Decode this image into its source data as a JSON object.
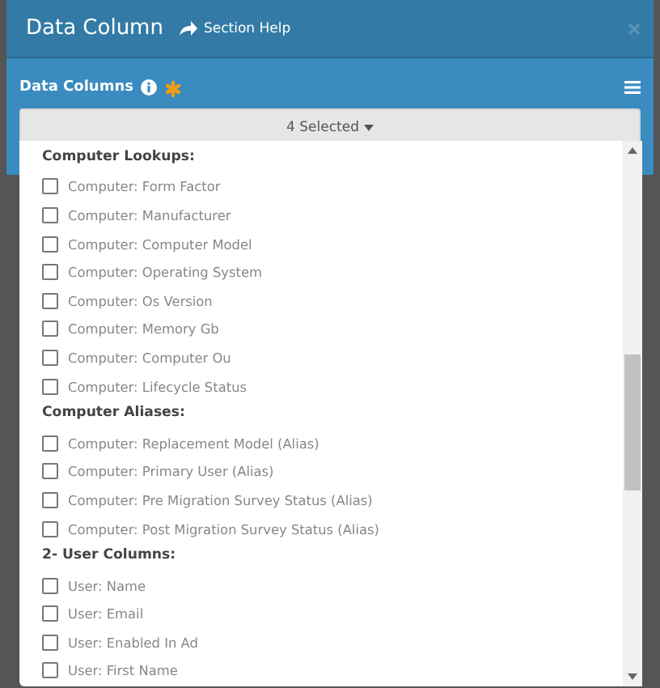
{
  "window": {
    "title": "Data Column",
    "help_link": "Section Help"
  },
  "field": {
    "label": "Data Columns",
    "required": true,
    "dropdown_value": "4 Selected"
  },
  "groups": [
    {
      "title": "Computer Lookups:",
      "items": [
        {
          "label": "Computer: Form Factor",
          "checked": false
        },
        {
          "label": "Computer: Manufacturer",
          "checked": false
        },
        {
          "label": "Computer: Computer Model",
          "checked": false
        },
        {
          "label": "Computer: Operating System",
          "checked": false
        },
        {
          "label": "Computer: Os Version",
          "checked": false
        },
        {
          "label": "Computer: Memory Gb",
          "checked": false
        },
        {
          "label": "Computer: Computer Ou",
          "checked": false
        },
        {
          "label": "Computer: Lifecycle Status",
          "checked": false
        }
      ]
    },
    {
      "title": "Computer Aliases:",
      "items": [
        {
          "label": "Computer: Replacement Model (Alias)",
          "checked": false
        },
        {
          "label": "Computer: Primary User (Alias)",
          "checked": false
        },
        {
          "label": "Computer: Pre Migration Survey Status (Alias)",
          "checked": false
        },
        {
          "label": "Computer: Post Migration Survey Status (Alias)",
          "checked": false
        }
      ]
    },
    {
      "title": "2- User Columns:",
      "items": [
        {
          "label": "User: Name",
          "checked": false
        },
        {
          "label": "User: Email",
          "checked": false
        },
        {
          "label": "User: Enabled In Ad",
          "checked": false
        },
        {
          "label": "User: First Name",
          "checked": false
        }
      ]
    }
  ]
}
